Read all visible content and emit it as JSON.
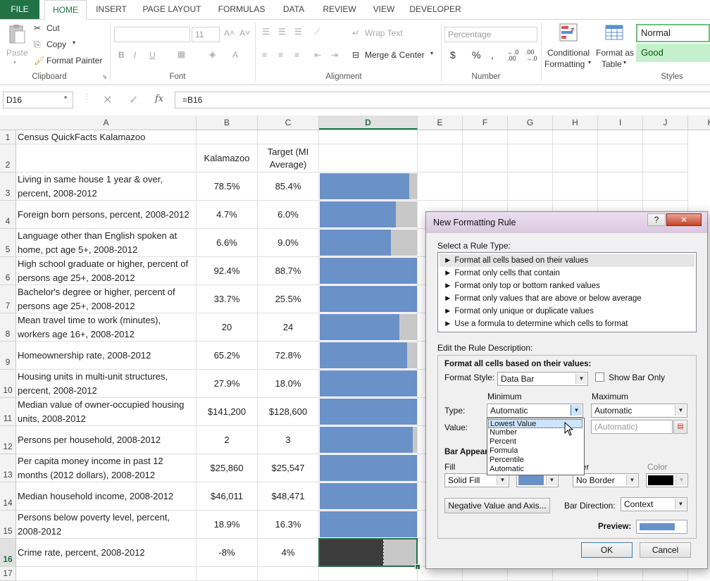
{
  "ribbon": {
    "tabs": [
      "FILE",
      "HOME",
      "INSERT",
      "PAGE LAYOUT",
      "FORMULAS",
      "DATA",
      "REVIEW",
      "VIEW",
      "DEVELOPER"
    ],
    "clipboard": {
      "paste": "Paste",
      "cut": "Cut",
      "copy": "Copy",
      "format_painter": "Format Painter",
      "label": "Clipboard"
    },
    "font": {
      "size": "11",
      "label": "Font"
    },
    "alignment": {
      "wrap": "Wrap Text",
      "merge": "Merge & Center",
      "label": "Alignment"
    },
    "number": {
      "format": "Percentage",
      "label": "Number"
    },
    "styles": {
      "conditional": "Conditional",
      "formatting": "Formatting",
      "format_as": "Format as",
      "table": "Table",
      "normal": "Normal",
      "good": "Good",
      "label": "Styles"
    }
  },
  "formula_bar": {
    "name_box": "D16",
    "fx": "fx",
    "formula": "=B16"
  },
  "columns": [
    "A",
    "B",
    "C",
    "D",
    "E",
    "F",
    "G",
    "H",
    "I",
    "J",
    "K"
  ],
  "rows": [
    {
      "n": "1",
      "a": "Census QuickFacts Kalamazoo",
      "b": "",
      "c": ""
    },
    {
      "n": "2",
      "a": "",
      "b": "Kalamazoo",
      "c": "Target (MI Average)"
    },
    {
      "n": "3",
      "a": "Living in same house 1 year & over, percent, 2008-2012",
      "b": "78.5%",
      "c": "85.4%"
    },
    {
      "n": "4",
      "a": "Foreign born persons, percent, 2008-2012",
      "b": "4.7%",
      "c": "6.0%"
    },
    {
      "n": "5",
      "a": "Language other than English spoken at home, pct age 5+, 2008-2012",
      "b": "6.6%",
      "c": "9.0%"
    },
    {
      "n": "6",
      "a": "High school graduate or higher, percent of persons age 25+, 2008-2012",
      "b": "92.4%",
      "c": "88.7%"
    },
    {
      "n": "7",
      "a": "Bachelor's degree or higher, percent of persons age 25+, 2008-2012",
      "b": "33.7%",
      "c": "25.5%"
    },
    {
      "n": "8",
      "a": "Mean travel time to work (minutes), workers age 16+, 2008-2012",
      "b": "20",
      "c": "24"
    },
    {
      "n": "9",
      "a": "Homeownership rate, 2008-2012",
      "b": "65.2%",
      "c": "72.8%"
    },
    {
      "n": "10",
      "a": "Housing units in multi-unit structures, percent, 2008-2012",
      "b": "27.9%",
      "c": "18.0%"
    },
    {
      "n": "11",
      "a": "Median value of owner-occupied housing units, 2008-2012",
      "b": "$141,200",
      "c": "$128,600"
    },
    {
      "n": "12",
      "a": "Persons per household, 2008-2012",
      "b": "2",
      "c": "3"
    },
    {
      "n": "13",
      "a": "Per capita money income in past 12 months (2012 dollars), 2008-2012",
      "b": "$25,860",
      "c": "$25,547"
    },
    {
      "n": "14",
      "a": "Median household income, 2008-2012",
      "b": "$46,011",
      "c": "$48,471"
    },
    {
      "n": "15",
      "a": "Persons below poverty level, percent, 2008-2012",
      "b": "18.9%",
      "c": "16.3%"
    },
    {
      "n": "16",
      "a": "Crime rate, percent, 2008-2012",
      "b": "-8%",
      "c": "4%"
    },
    {
      "n": "17",
      "a": "",
      "b": "",
      "c": ""
    }
  ],
  "data_bar_fill": [
    null,
    null,
    0.92,
    0.78,
    0.73,
    1.0,
    1.0,
    0.82,
    0.9,
    1.0,
    1.0,
    0.96,
    1.0,
    1.0,
    1.0,
    0.65,
    null
  ],
  "colors": {
    "excel_green": "#217346",
    "bar_blue": "#6b91c9",
    "bar_bg": "#c8c8c8",
    "selected_bar": "#3c3c3c",
    "dropdown_highlight": "#cde4fa"
  },
  "dialog": {
    "title": "New Formatting Rule",
    "help": "?",
    "select_rule_type": "Select a Rule Type:",
    "rule_types": [
      "Format all cells based on their values",
      "Format only cells that contain",
      "Format only top or bottom ranked values",
      "Format only values that are above or below average",
      "Format only unique or duplicate values",
      "Use a formula to determine which cells to format"
    ],
    "edit_description": "Edit the Rule Description:",
    "format_all_heading": "Format all cells based on their values:",
    "format_style_label": "Format Style:",
    "format_style_value": "Data Bar",
    "show_bar_only": "Show Bar Only",
    "minimum": "Minimum",
    "maximum": "Maximum",
    "type_label": "Type:",
    "value_label": "Value:",
    "min_type": "Automatic",
    "max_type": "Automatic",
    "max_value": "(Automatic)",
    "type_options": [
      "Lowest Value",
      "Number",
      "Percent",
      "Formula",
      "Percentile",
      "Automatic"
    ],
    "bar_appearance": "Bar Appear",
    "fill_label": "Fill",
    "fill_value": "Solid Fill",
    "border_label": "rder",
    "border_value": "No Border",
    "color_label": "Color",
    "negative_button": "Negative Value and Axis...",
    "bar_direction_label": "Bar Direction:",
    "bar_direction_value": "Context",
    "preview_label": "Preview:",
    "ok": "OK",
    "cancel": "Cancel"
  }
}
